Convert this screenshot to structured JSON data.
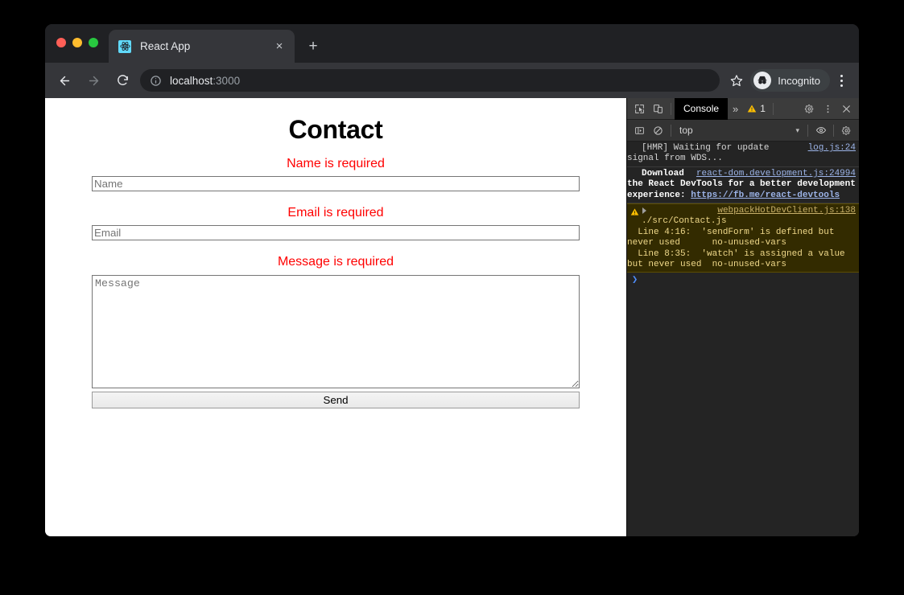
{
  "browser": {
    "tab": {
      "title": "React App",
      "favicon": "react-logo-icon",
      "close": "×"
    },
    "new_tab": "+",
    "nav": {
      "back": "←",
      "forward": "→",
      "reload": "⟳"
    },
    "omnibox": {
      "host": "localhost",
      "port": ":3000",
      "site_info": "info-icon"
    },
    "star": "☆",
    "incognito": {
      "label": "Incognito",
      "icon": "incognito-icon"
    },
    "menu": "kebab-menu-icon"
  },
  "page": {
    "title": "Contact",
    "errors": {
      "name": "Name is required",
      "email": "Email is required",
      "message": "Message is required"
    },
    "fields": {
      "name_placeholder": "Name",
      "name_value": "",
      "email_placeholder": "Email",
      "email_value": "",
      "message_placeholder": "Message",
      "message_value": ""
    },
    "submit_label": "Send",
    "error_color": "#ff0000"
  },
  "devtools": {
    "toolbar": {
      "inspect": "inspect-element-icon",
      "device": "device-toolbar-icon",
      "active_tab": "Console",
      "more_tabs": "»",
      "warning_count": "1",
      "settings": "gear-icon",
      "menu": "kebab-menu-icon",
      "close": "×"
    },
    "filterbar": {
      "sidebar_toggle": "sidebar-toggle-icon",
      "clear": "clear-console-icon",
      "context": "top",
      "caret": "▾",
      "eye": "live-expression-icon",
      "settings": "gear-icon"
    },
    "messages": [
      {
        "type": "log",
        "source": "log.js:24",
        "text": "[HMR] Waiting for update signal from WDS...",
        "bold": false
      },
      {
        "type": "log",
        "source": "react-dom.development.js:24994",
        "text": "Download the React DevTools for a better development experience: ",
        "link": "https://fb.me/react-devtools",
        "bold": true
      },
      {
        "type": "warning",
        "source": "webpackHotDevClient.js:138",
        "text": "./src/Contact.js\n  Line 4:16:  'sendForm' is defined but never used      no-unused-vars\n  Line 8:35:  'watch' is assigned a value but never used  no-unused-vars",
        "bold": false
      }
    ],
    "prompt": "❯"
  }
}
